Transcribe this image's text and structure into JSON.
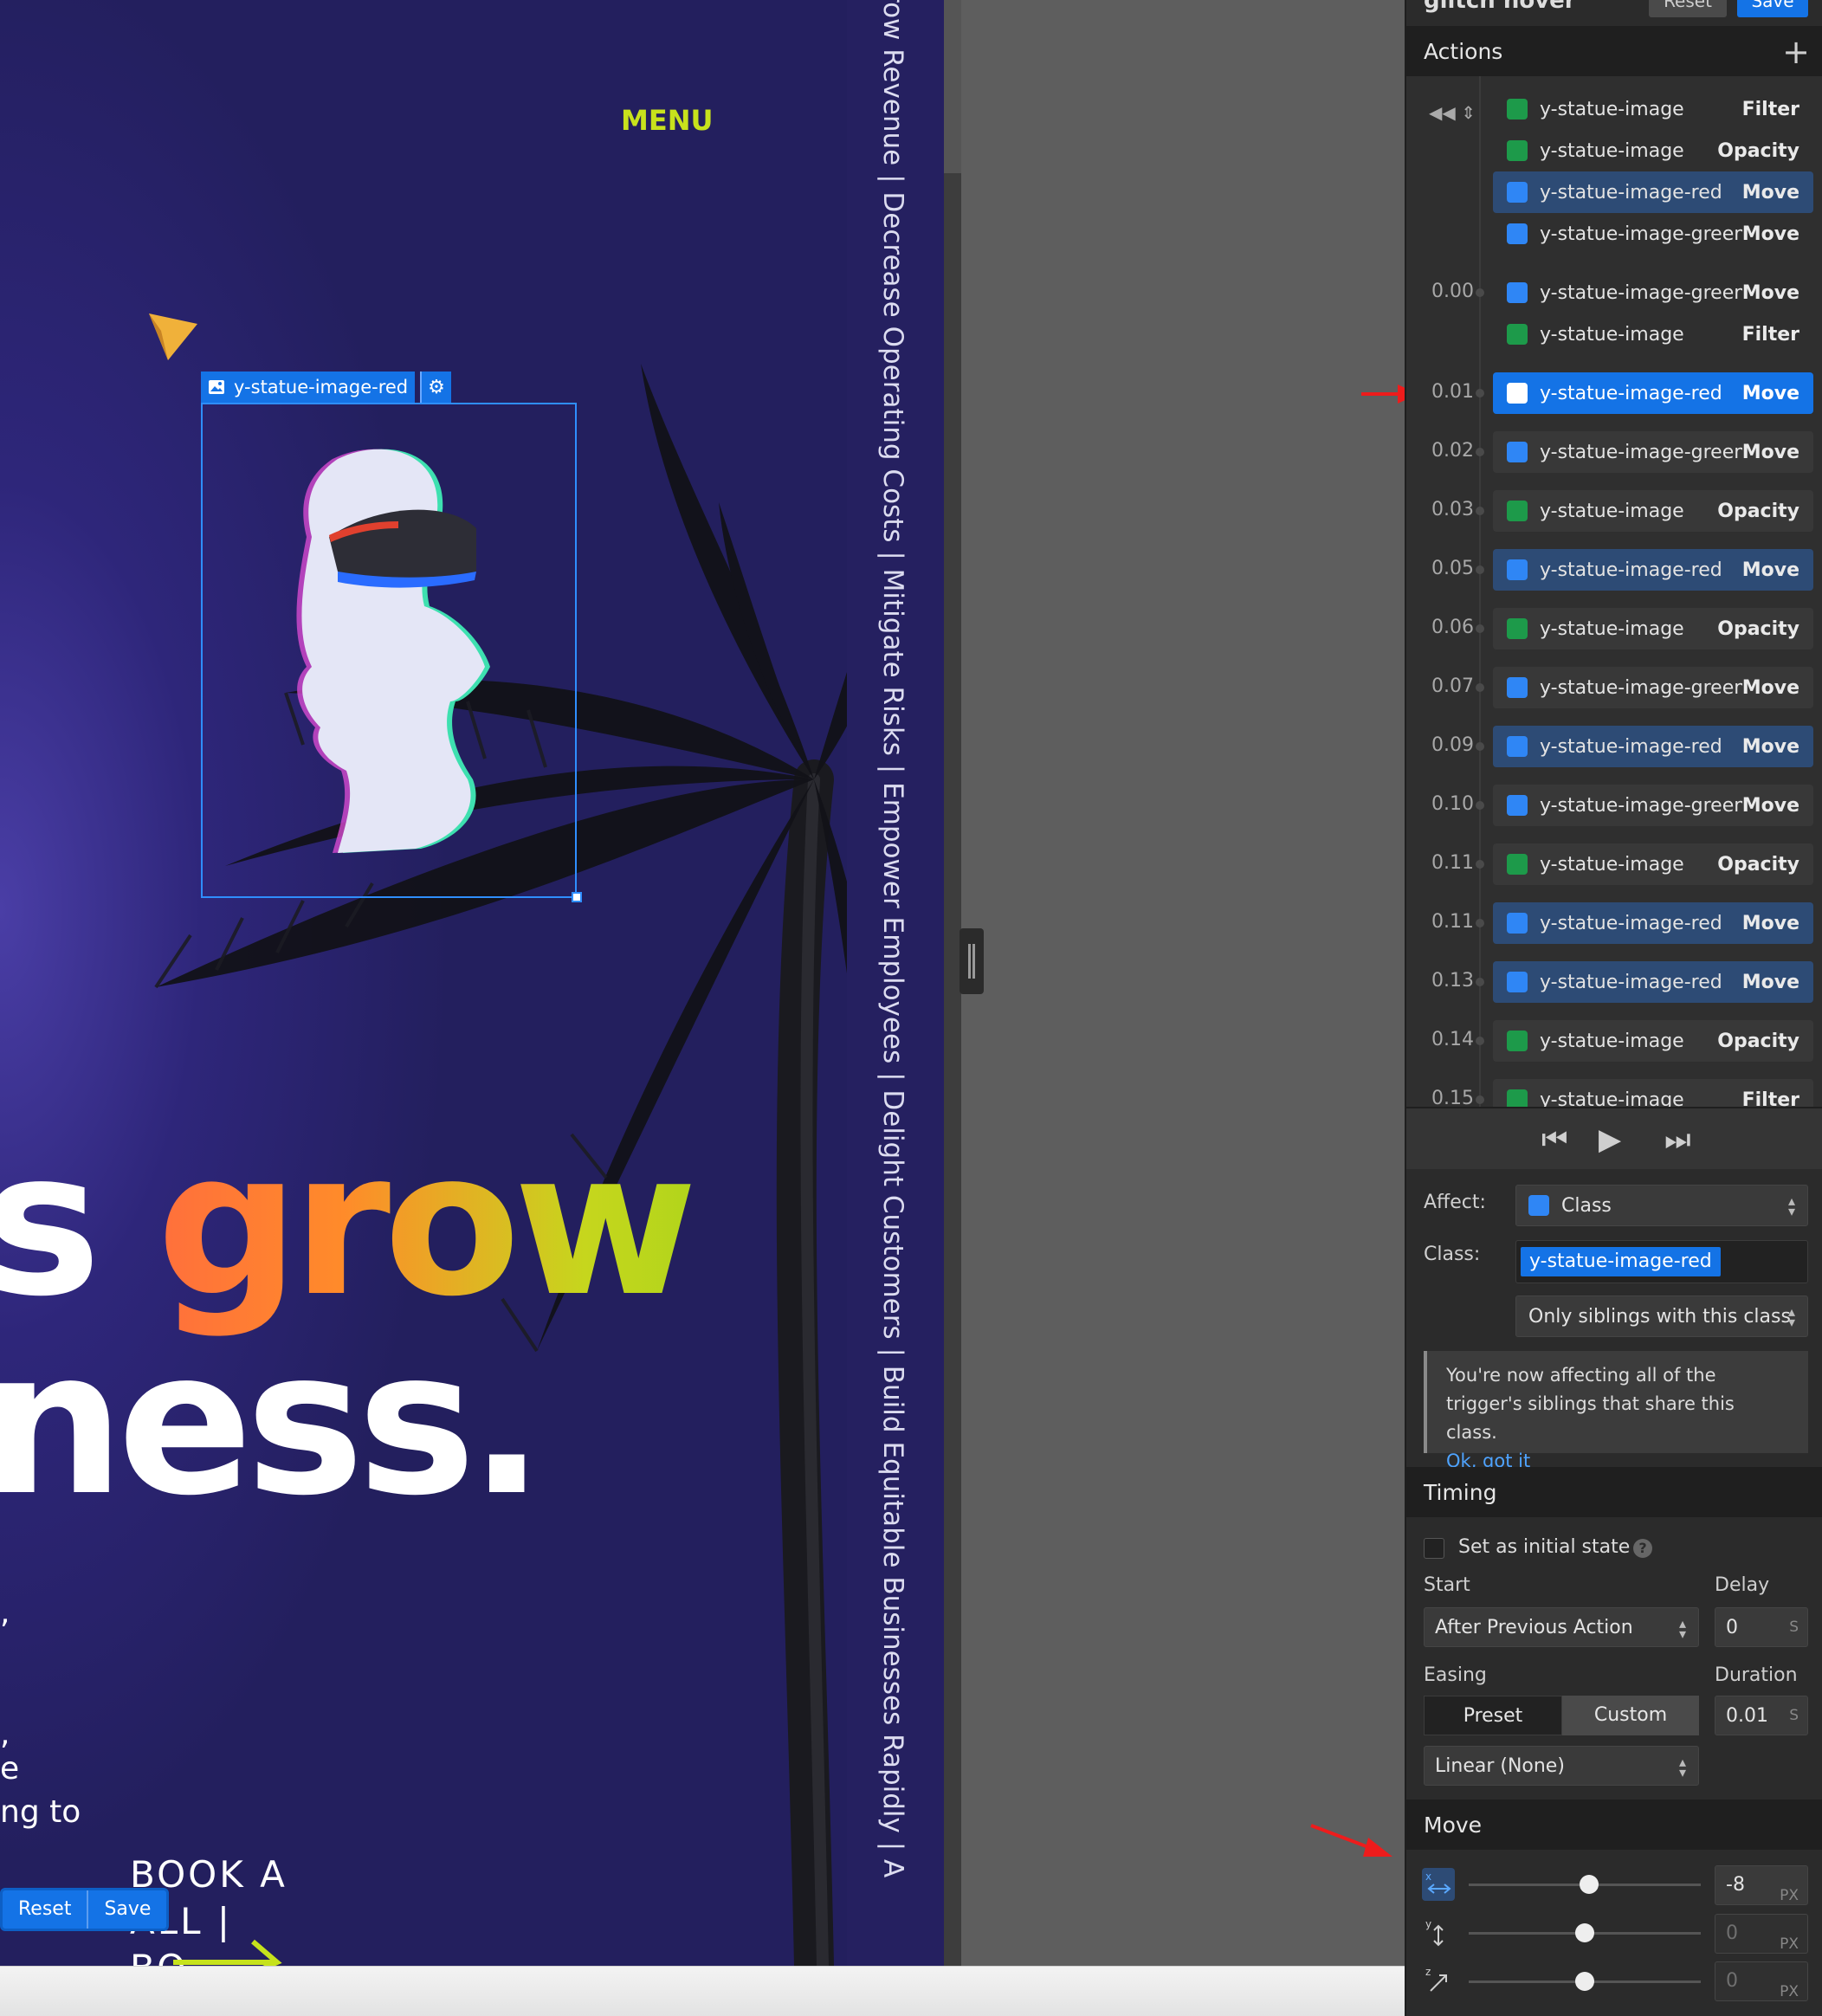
{
  "canvas": {
    "menu_label": "MENU",
    "ticker_text": "row Revenue  |  Decrease Operating Costs  |  Mitigate Risks  |  Empower Employees  |  Delight Customers  |  Build Equitable Businesses Rapidly  |  A",
    "selected_element": "y-statue-image-red",
    "headline_prefix": "s",
    "headline_highlight": "grow",
    "headline_line2": "ness.",
    "body_fragments": [
      ",",
      ",",
      "e",
      "ng to"
    ],
    "cta_lines": [
      "BOOK A",
      "ALL |",
      "BO"
    ],
    "mini_reset": "Reset",
    "mini_save": "Save"
  },
  "panel": {
    "interaction_name": "glitch hover",
    "reset_label": "Reset",
    "save_label": "Save",
    "actions_title": "Actions",
    "timeline": {
      "groups": [
        {
          "time": "",
          "rows": [
            {
              "target": "y-statue-image",
              "action": "Filter",
              "icon": "bolt"
            },
            {
              "target": "y-statue-image",
              "action": "Opacity",
              "icon": "bolt"
            },
            {
              "target": "y-statue-image-red",
              "action": "Move",
              "icon": "brush",
              "highlight": true
            },
            {
              "target": "y-statue-image-green",
              "action": "Move",
              "icon": "brush"
            }
          ]
        },
        {
          "time": "0.00",
          "rows": [
            {
              "target": "y-statue-image-green",
              "action": "Move",
              "icon": "brush"
            },
            {
              "target": "y-statue-image",
              "action": "Filter",
              "icon": "bolt"
            }
          ]
        }
      ],
      "rows": [
        {
          "time": "0.01",
          "target": "y-statue-image-red",
          "action": "Move",
          "icon": "brush",
          "active": true
        },
        {
          "time": "0.02",
          "target": "y-statue-image-green",
          "action": "Move",
          "icon": "brush"
        },
        {
          "time": "0.03",
          "target": "y-statue-image",
          "action": "Opacity",
          "icon": "bolt"
        },
        {
          "time": "0.05",
          "target": "y-statue-image-red",
          "action": "Move",
          "icon": "brush",
          "highlight": true
        },
        {
          "time": "0.06",
          "target": "y-statue-image",
          "action": "Opacity",
          "icon": "bolt"
        },
        {
          "time": "0.07",
          "target": "y-statue-image-green",
          "action": "Move",
          "icon": "brush"
        },
        {
          "time": "0.09",
          "target": "y-statue-image-red",
          "action": "Move",
          "icon": "brush",
          "highlight": true
        },
        {
          "time": "0.10",
          "target": "y-statue-image-green",
          "action": "Move",
          "icon": "brush"
        },
        {
          "time": "0.11",
          "target": "y-statue-image",
          "action": "Opacity",
          "icon": "bolt"
        },
        {
          "time": "0.11",
          "target": "y-statue-image-red",
          "action": "Move",
          "icon": "brush",
          "highlight": true
        },
        {
          "time": "0.13",
          "target": "y-statue-image-red",
          "action": "Move",
          "icon": "brush",
          "highlight": true
        },
        {
          "time": "0.14",
          "target": "y-statue-image",
          "action": "Opacity",
          "icon": "bolt"
        },
        {
          "time": "0.15",
          "target": "y-statue-image",
          "action": "Filter",
          "icon": "bolt"
        }
      ]
    },
    "affect_label": "Affect:",
    "affect_value": "Class",
    "class_label": "Class:",
    "class_value": "y-statue-image-red",
    "sibling_scope": "Only siblings with this class",
    "notice_text": "You're now affecting all of the trigger's siblings that share this class.",
    "notice_link": "Ok, got it",
    "timing_title": "Timing",
    "initial_state_label": "Set as initial state",
    "start_label": "Start",
    "start_value": "After Previous Action",
    "delay_label": "Delay",
    "delay_value": "0",
    "delay_unit": "S",
    "easing_label": "Easing",
    "easing_preset": "Preset",
    "easing_custom": "Custom",
    "duration_label": "Duration",
    "duration_value": "0.01",
    "duration_unit": "S",
    "easing_value": "Linear (None)",
    "move_title": "Move",
    "move": {
      "x": {
        "value": "-8",
        "unit": "PX",
        "slider": 0.52
      },
      "y": {
        "value": "0",
        "unit": "PX",
        "slider": 0.5
      },
      "z": {
        "value": "0",
        "unit": "PX",
        "slider": 0.5
      }
    }
  }
}
